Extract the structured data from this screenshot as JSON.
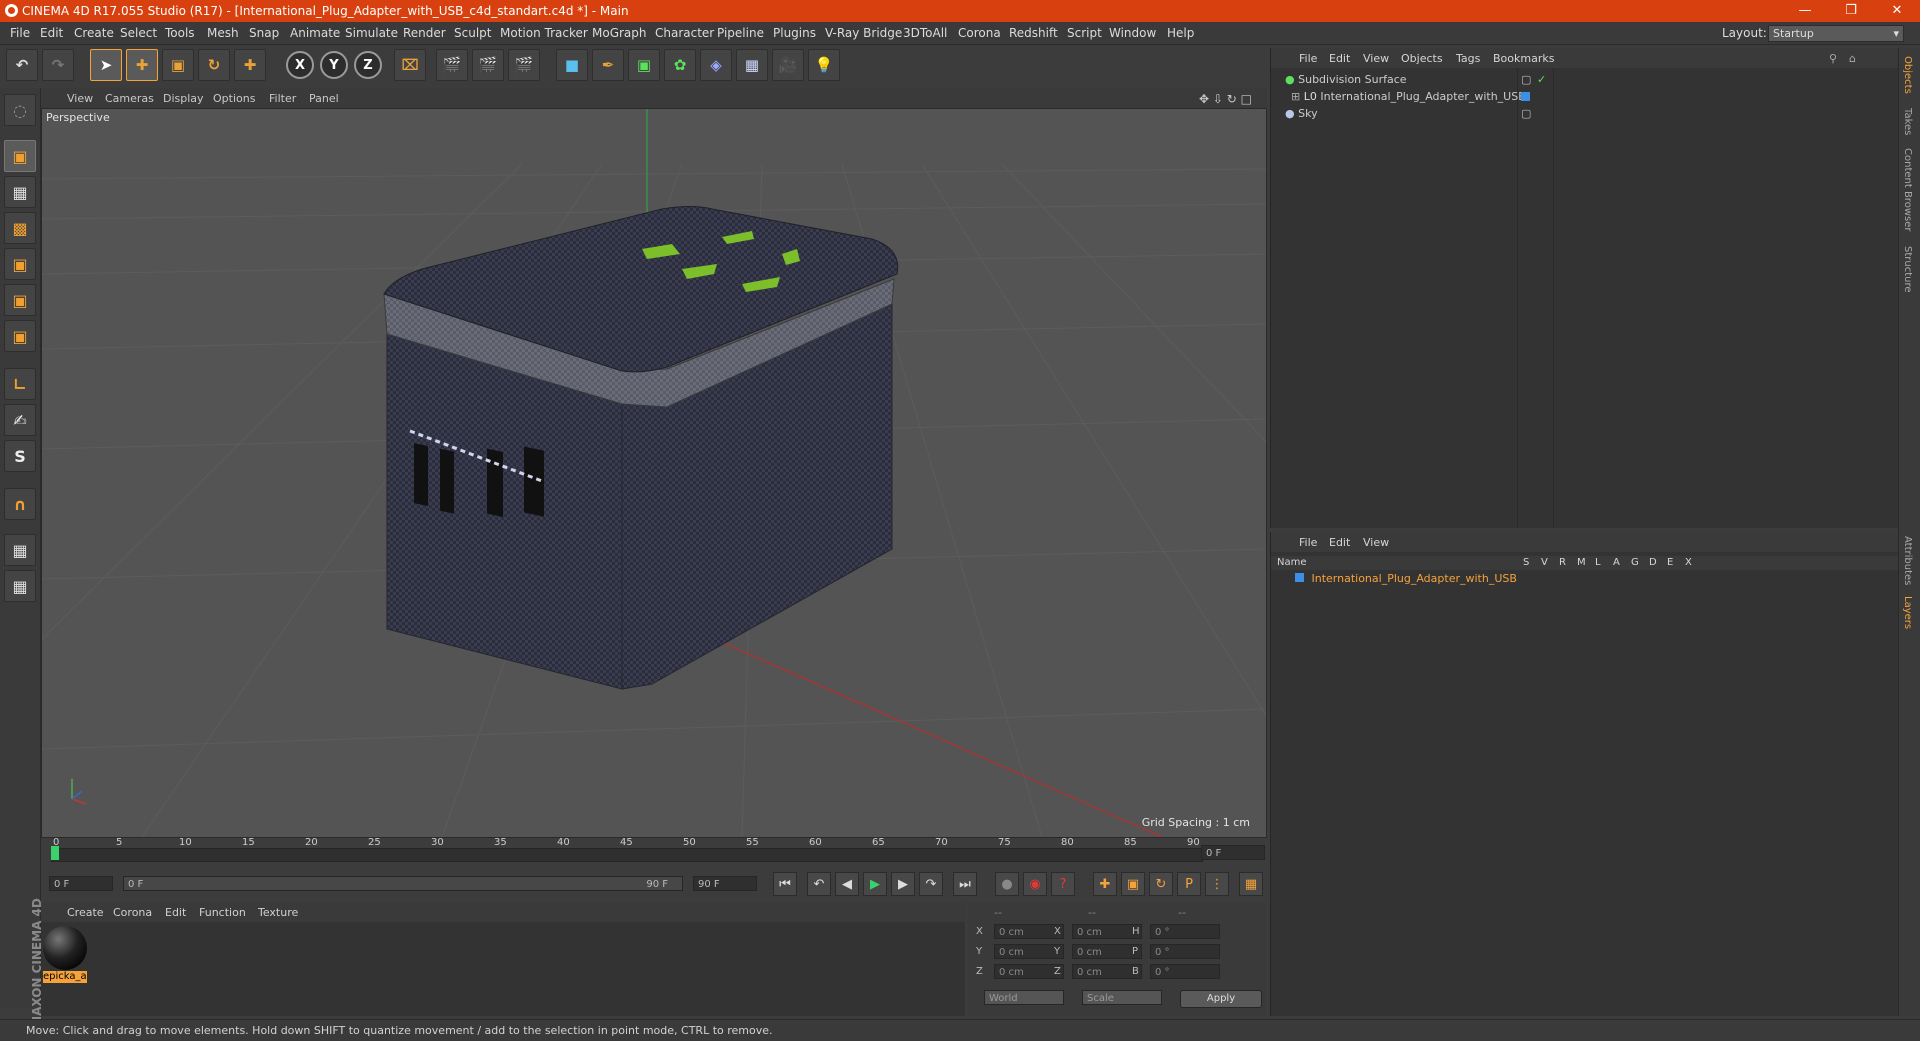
{
  "title": "CINEMA 4D R17.055 Studio (R17) - [International_Plug_Adapter_with_USB_c4d_standart.c4d *] - Main",
  "menus": [
    "File",
    "Edit",
    "Create",
    "Select",
    "Tools",
    "Mesh",
    "Snap",
    "Animate",
    "Simulate",
    "Render",
    "Sculpt",
    "Motion Tracker",
    "MoGraph",
    "Character",
    "Pipeline",
    "Plugins",
    "V-Ray Bridge",
    "3DToAll",
    "Corona",
    "Redshift",
    "Script",
    "Window",
    "Help"
  ],
  "layout": {
    "label": "Layout:",
    "value": "Startup"
  },
  "toolbar": {
    "x": "X",
    "y": "Y",
    "z": "Z"
  },
  "viewport": {
    "menu": [
      "View",
      "Cameras",
      "Display",
      "Options",
      "Filter",
      "Panel"
    ],
    "label": "Perspective",
    "grid_spacing": "Grid Spacing : 1 cm"
  },
  "timeline": {
    "ticks": [
      "0",
      "5",
      "10",
      "15",
      "20",
      "25",
      "30",
      "35",
      "40",
      "45",
      "50",
      "55",
      "60",
      "65",
      "70",
      "75",
      "80",
      "85",
      "90"
    ],
    "current": "0 F"
  },
  "transport": {
    "start": "0 F",
    "range_start": "0 F",
    "range_end": "90 F",
    "end": "90 F"
  },
  "material": {
    "menu": [
      "Create",
      "Corona",
      "Edit",
      "Function",
      "Texture"
    ],
    "item_name": "epicka_a"
  },
  "coords": {
    "rows": [
      {
        "a": "X",
        "av": "0 cm",
        "b": "X",
        "bv": "0 cm",
        "c": "H",
        "cv": "0 °"
      },
      {
        "a": "Y",
        "av": "0 cm",
        "b": "Y",
        "bv": "0 cm",
        "c": "P",
        "cv": "0 °"
      },
      {
        "a": "Z",
        "av": "0 cm",
        "b": "Z",
        "bv": "0 cm",
        "c": "B",
        "cv": "0 °"
      }
    ],
    "world": "World",
    "scale": "Scale",
    "apply": "Apply",
    "dashes": [
      "--",
      "--",
      "--"
    ]
  },
  "objects": {
    "menu": [
      "File",
      "Edit",
      "View",
      "Objects",
      "Tags",
      "Bookmarks"
    ],
    "items": [
      "Subdivision Surface",
      "International_Plug_Adapter_with_USB",
      "Sky"
    ]
  },
  "layers": {
    "menu": [
      "File",
      "Edit",
      "View"
    ],
    "header": {
      "name": "Name",
      "cols": [
        "S",
        "V",
        "R",
        "M",
        "L",
        "A",
        "G",
        "D",
        "E",
        "X"
      ]
    },
    "item": "International_Plug_Adapter_with_USB"
  },
  "right_tabs": [
    "Objects",
    "Takes",
    "Content Browser",
    "Structure",
    "Attributes",
    "Layers"
  ],
  "status": "Move: Click and drag to move elements. Hold down SHIFT to quantize movement / add to the selection in point mode, CTRL to remove.",
  "brand": "MAXON CINEMA 4D",
  "colors": {
    "title_bar": "#d8410f",
    "accent": "#f5a23b",
    "layer_item": "#f5a23b"
  }
}
